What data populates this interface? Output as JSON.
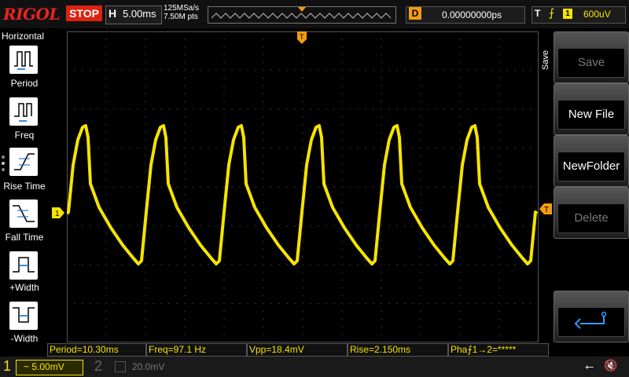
{
  "brand": "RIGOL",
  "run_state": "STOP",
  "horizontal": {
    "letter": "H",
    "timebase": "5.00ms",
    "sample_rate": "125MSa/s",
    "points": "7.50M pts"
  },
  "delay": {
    "letter": "D",
    "value": "0.00000000ps"
  },
  "trigger": {
    "letter": "T",
    "edge": "⨍",
    "source": "1",
    "level": "600uV"
  },
  "left_menu": {
    "title": "Horizontal",
    "items": [
      {
        "label": "Period"
      },
      {
        "label": "Freq"
      },
      {
        "label": "Rise Time"
      },
      {
        "label": "Fall Time"
      },
      {
        "label": "+Width"
      },
      {
        "label": "-Width"
      }
    ]
  },
  "right_menu": {
    "title": "Save",
    "buttons": [
      {
        "label": "Save"
      },
      {
        "label": "New File"
      },
      {
        "label": "NewFolder"
      },
      {
        "label": "Delete"
      }
    ]
  },
  "measurements": {
    "period": "Period=10.30ms",
    "freq": "Freq=97.1 Hz",
    "vpp": "Vpp=18.4mV",
    "rise": "Rise=2.150ms",
    "phase": "Pha⨍1→2=*****"
  },
  "markers": {
    "ch1": "1",
    "trigger_top": "T",
    "trigger_right": "T"
  },
  "channels": {
    "ch1": {
      "number": "1",
      "scale": "~ 5.00mV",
      "color": "#f5e400"
    },
    "ch2": {
      "number": "2",
      "scale": "20.0mV",
      "color": "#666666"
    }
  },
  "colors": {
    "trace": "#f5e400",
    "accent": "#f39c12",
    "stop": "#dd2211"
  }
}
